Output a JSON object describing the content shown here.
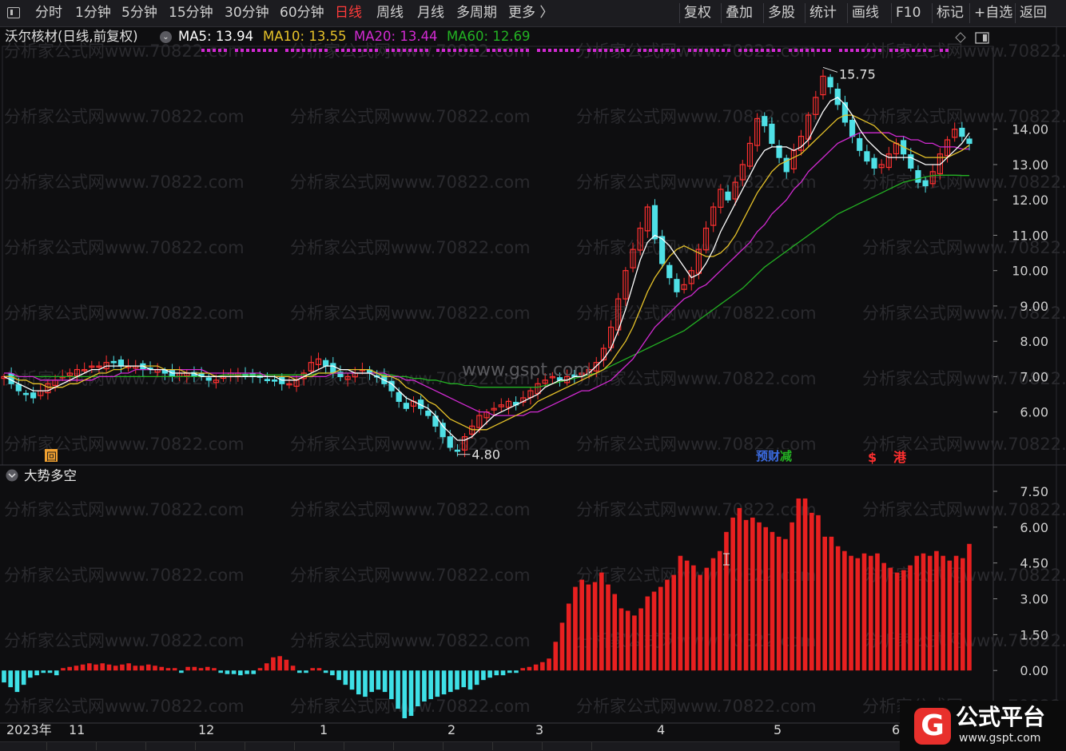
{
  "toolbar": {
    "left": [
      "分时",
      "1分钟",
      "5分钟",
      "15分钟",
      "30分钟",
      "60分钟",
      "日线",
      "周线",
      "月线",
      "多周期",
      "更多 〉"
    ],
    "active_index": 6,
    "right": [
      "复权",
      "叠加",
      "多股",
      "统计",
      "画线",
      "F10",
      "标记",
      "+自选",
      "返回"
    ]
  },
  "info": {
    "stock": "沃尔核材(日线,前复权)",
    "ma": [
      {
        "label": "MA5: 13.94",
        "color": "#ffffff"
      },
      {
        "label": "MA10: 13.55",
        "color": "#e6c229"
      },
      {
        "label": "MA20: 13.44",
        "color": "#d22ad2"
      },
      {
        "label": "MA60: 12.69",
        "color": "#23b223"
      }
    ]
  },
  "indicator": {
    "name": "大势多空"
  },
  "chart_data": {
    "type": "candlestick",
    "price_axis": {
      "ticks": [
        "14.00",
        "13.00",
        "12.00",
        "11.00",
        "10.00",
        "9.00",
        "8.00",
        "7.00",
        "6.00"
      ],
      "range": [
        4.5,
        16.3
      ]
    },
    "indicator_axis": {
      "ticks": [
        "7.50",
        "6.00",
        "4.50",
        "3.00",
        "1.50",
        "0.00"
      ],
      "range": [
        -2.2,
        8.0
      ]
    },
    "x_labels": [
      "2023年",
      "11",
      "12",
      "1",
      "2",
      "3",
      "4",
      "5",
      "6"
    ],
    "high_mark": "15.75",
    "low_mark": "4.80",
    "price_close": [
      7.0,
      6.8,
      6.6,
      6.5,
      6.4,
      6.6,
      6.8,
      6.9,
      7.0,
      7.1,
      7.2,
      7.2,
      7.3,
      7.3,
      7.4,
      7.4,
      7.3,
      7.3,
      7.3,
      7.2,
      7.2,
      7.2,
      7.1,
      7.0,
      7.1,
      7.1,
      7.0,
      7.0,
      6.9,
      6.9,
      7.0,
      7.1,
      7.1,
      7.0,
      7.0,
      7.0,
      6.9,
      6.9,
      6.8,
      6.8,
      6.9,
      7.1,
      7.4,
      7.5,
      7.3,
      7.1,
      7.0,
      7.0,
      7.1,
      7.2,
      7.1,
      7.0,
      6.8,
      6.6,
      6.3,
      6.1,
      6.3,
      6.1,
      5.9,
      5.6,
      5.3,
      5.0,
      4.9,
      5.3,
      5.6,
      5.9,
      6.0,
      6.1,
      6.2,
      6.3,
      6.2,
      6.4,
      6.6,
      6.8,
      6.9,
      7.0,
      6.9,
      7.0,
      7.0,
      7.1,
      7.2,
      7.4,
      7.8,
      8.4,
      9.2,
      10.0,
      10.6,
      11.2,
      11.8,
      10.9,
      10.2,
      9.8,
      9.4,
      9.6,
      10.0,
      10.6,
      11.2,
      11.8,
      12.3,
      12.0,
      12.5,
      13.0,
      13.6,
      14.3,
      14.1,
      13.6,
      13.2,
      12.8,
      13.4,
      13.8,
      14.4,
      14.9,
      15.5,
      15.2,
      14.7,
      14.2,
      13.8,
      13.4,
      13.1,
      12.9,
      13.0,
      13.3,
      13.6,
      13.3,
      12.9,
      12.5,
      12.4,
      12.8,
      13.3,
      13.7,
      14.0,
      13.8,
      13.6
    ],
    "ma5": [
      7.0,
      6.9,
      6.8,
      6.7,
      6.6,
      6.6,
      6.6,
      6.7,
      6.8,
      6.9,
      7.0,
      7.1,
      7.2,
      7.2,
      7.3,
      7.3,
      7.3,
      7.3,
      7.3,
      7.3,
      7.2,
      7.2,
      7.2,
      7.1,
      7.1,
      7.1,
      7.1,
      7.0,
      7.0,
      7.0,
      7.0,
      7.0,
      7.0,
      7.0,
      7.0,
      7.0,
      7.0,
      7.0,
      6.9,
      6.9,
      6.9,
      7.0,
      7.1,
      7.2,
      7.3,
      7.3,
      7.2,
      7.2,
      7.1,
      7.1,
      7.1,
      7.0,
      6.9,
      6.8,
      6.6,
      6.4,
      6.3,
      6.2,
      6.1,
      5.9,
      5.6,
      5.4,
      5.2,
      5.2,
      5.3,
      5.5,
      5.7,
      5.9,
      6.0,
      6.1,
      6.2,
      6.3,
      6.4,
      6.5,
      6.7,
      6.8,
      6.9,
      6.9,
      7.0,
      7.0,
      7.1,
      7.3,
      7.5,
      7.8,
      8.3,
      8.9,
      9.6,
      10.3,
      10.8,
      11.0,
      10.9,
      10.7,
      10.4,
      10.1,
      9.8,
      9.9,
      10.2,
      10.6,
      11.1,
      11.5,
      11.9,
      12.3,
      12.7,
      13.1,
      13.4,
      13.5,
      13.5,
      13.5,
      13.4,
      13.5,
      13.7,
      14.1,
      14.5,
      14.8,
      14.9,
      14.7,
      14.4,
      14.0,
      13.7,
      13.5,
      13.3,
      13.2,
      13.2,
      13.2,
      13.2,
      13.1,
      13.0,
      13.0,
      13.0,
      13.2,
      13.4,
      13.6,
      13.9
    ],
    "ma10": [
      7.0,
      7.0,
      6.9,
      6.9,
      6.8,
      6.8,
      6.7,
      6.7,
      6.7,
      6.8,
      6.8,
      6.9,
      7.0,
      7.1,
      7.1,
      7.2,
      7.2,
      7.3,
      7.3,
      7.3,
      7.3,
      7.3,
      7.2,
      7.2,
      7.2,
      7.1,
      7.1,
      7.1,
      7.1,
      7.0,
      7.0,
      7.0,
      7.0,
      7.0,
      7.0,
      7.0,
      7.0,
      7.0,
      7.0,
      7.0,
      6.9,
      7.0,
      7.0,
      7.1,
      7.1,
      7.1,
      7.2,
      7.2,
      7.2,
      7.2,
      7.2,
      7.1,
      7.0,
      7.0,
      6.9,
      6.7,
      6.6,
      6.5,
      6.3,
      6.2,
      6.0,
      5.8,
      5.7,
      5.6,
      5.5,
      5.5,
      5.5,
      5.6,
      5.7,
      5.8,
      5.9,
      6.0,
      6.1,
      6.3,
      6.4,
      6.5,
      6.6,
      6.7,
      6.8,
      6.9,
      7.0,
      7.1,
      7.2,
      7.4,
      7.7,
      8.0,
      8.4,
      8.9,
      9.4,
      9.8,
      10.1,
      10.4,
      10.6,
      10.7,
      10.6,
      10.5,
      10.4,
      10.4,
      10.5,
      10.7,
      11.0,
      11.4,
      11.8,
      12.2,
      12.5,
      12.8,
      13.0,
      13.1,
      13.2,
      13.3,
      13.5,
      13.7,
      13.9,
      14.1,
      14.3,
      14.4,
      14.4,
      14.3,
      14.2,
      14.1,
      13.9,
      13.7,
      13.6,
      13.5,
      13.4,
      13.3,
      13.2,
      13.2,
      13.2,
      13.2,
      13.3,
      13.4,
      13.55
    ],
    "ma20": [
      7.1,
      7.1,
      7.0,
      7.0,
      7.0,
      6.9,
      6.9,
      6.9,
      6.9,
      6.9,
      6.9,
      6.9,
      6.9,
      7.0,
      7.0,
      7.0,
      7.1,
      7.1,
      7.2,
      7.2,
      7.2,
      7.2,
      7.2,
      7.2,
      7.2,
      7.2,
      7.2,
      7.2,
      7.1,
      7.1,
      7.1,
      7.1,
      7.1,
      7.1,
      7.1,
      7.1,
      7.0,
      7.0,
      7.0,
      7.0,
      7.0,
      7.0,
      7.0,
      7.0,
      7.0,
      7.1,
      7.1,
      7.1,
      7.1,
      7.1,
      7.1,
      7.1,
      7.1,
      7.0,
      7.0,
      6.9,
      6.9,
      6.8,
      6.7,
      6.6,
      6.5,
      6.4,
      6.3,
      6.2,
      6.1,
      6.0,
      6.0,
      5.9,
      5.9,
      5.9,
      5.9,
      5.9,
      6.0,
      6.0,
      6.1,
      6.2,
      6.3,
      6.4,
      6.5,
      6.6,
      6.6,
      6.7,
      6.8,
      6.9,
      7.1,
      7.3,
      7.5,
      7.8,
      8.1,
      8.4,
      8.6,
      8.8,
      9.0,
      9.2,
      9.3,
      9.5,
      9.6,
      9.8,
      10.0,
      10.2,
      10.4,
      10.6,
      10.8,
      11.1,
      11.3,
      11.6,
      11.8,
      12.0,
      12.3,
      12.5,
      12.8,
      13.0,
      13.2,
      13.4,
      13.6,
      13.7,
      13.8,
      13.9,
      13.9,
      13.9,
      13.9,
      13.9,
      13.8,
      13.8,
      13.7,
      13.7,
      13.6,
      13.6,
      13.5,
      13.5,
      13.5,
      13.44,
      13.44
    ],
    "ma60": [
      7.0,
      7.0,
      7.0,
      7.0,
      7.0,
      7.0,
      7.0,
      7.0,
      7.0,
      7.0,
      7.0,
      7.0,
      7.0,
      7.0,
      7.0,
      7.0,
      7.0,
      7.0,
      7.0,
      7.0,
      7.0,
      7.0,
      7.0,
      7.0,
      7.0,
      7.0,
      7.0,
      7.0,
      7.0,
      7.0,
      7.05,
      7.05,
      7.05,
      7.05,
      7.05,
      7.05,
      7.05,
      7.05,
      7.05,
      7.05,
      7.05,
      7.05,
      7.05,
      7.1,
      7.1,
      7.1,
      7.1,
      7.1,
      7.1,
      7.1,
      7.1,
      7.1,
      7.05,
      7.05,
      7.0,
      7.0,
      6.95,
      6.95,
      6.9,
      6.9,
      6.85,
      6.8,
      6.8,
      6.75,
      6.75,
      6.7,
      6.7,
      6.7,
      6.7,
      6.7,
      6.7,
      6.7,
      6.7,
      6.7,
      6.75,
      6.8,
      6.85,
      6.9,
      6.95,
      7.0,
      7.05,
      7.1,
      7.2,
      7.3,
      7.4,
      7.5,
      7.6,
      7.7,
      7.8,
      7.9,
      8.0,
      8.1,
      8.2,
      8.3,
      8.45,
      8.6,
      8.75,
      8.9,
      9.05,
      9.2,
      9.35,
      9.5,
      9.7,
      9.9,
      10.1,
      10.25,
      10.4,
      10.55,
      10.7,
      10.85,
      11.0,
      11.15,
      11.3,
      11.45,
      11.6,
      11.7,
      11.8,
      11.9,
      12.0,
      12.1,
      12.2,
      12.3,
      12.4,
      12.5,
      12.55,
      12.6,
      12.65,
      12.69,
      12.7,
      12.7,
      12.7,
      12.69,
      12.69
    ],
    "indicator_values": [
      -0.5,
      -0.7,
      -0.9,
      -0.6,
      -0.3,
      -0.2,
      -0.1,
      -0.1,
      -0.2,
      0.1,
      0.15,
      0.2,
      0.25,
      0.3,
      0.25,
      0.3,
      0.25,
      0.2,
      0.25,
      0.3,
      0.2,
      0.2,
      0.25,
      0.2,
      0.15,
      0.1,
      0.1,
      -0.1,
      0.15,
      0.15,
      0.1,
      0.15,
      0.1,
      -0.1,
      -0.15,
      -0.15,
      -0.2,
      -0.15,
      -0.15,
      0.1,
      0.3,
      0.55,
      0.6,
      0.45,
      0.2,
      -0.1,
      -0.1,
      0.1,
      0.1,
      -0.1,
      -0.2,
      -0.4,
      -0.6,
      -0.8,
      -1.0,
      -1.1,
      -0.9,
      -0.8,
      -0.9,
      -1.2,
      -1.6,
      -2.0,
      -1.9,
      -1.5,
      -1.3,
      -1.2,
      -1.1,
      -1.0,
      -0.9,
      -0.8,
      -0.7,
      -0.8,
      -0.6,
      -0.4,
      -0.3,
      -0.2,
      -0.2,
      -0.1,
      -0.1,
      0.1,
      0.15,
      0.25,
      0.35,
      0.5,
      1.2,
      2.0,
      2.8,
      3.5,
      3.8,
      3.6,
      3.7,
      4.1,
      3.6,
      3.2,
      2.6,
      2.5,
      2.3,
      2.6,
      3.1,
      3.3,
      3.5,
      3.8,
      4.0,
      4.8,
      4.6,
      4.4,
      4.0,
      4.3,
      4.7,
      5.0,
      5.8,
      6.4,
      6.8,
      6.3,
      6.4,
      6.2,
      6.0,
      5.8,
      5.6,
      5.5,
      6.2,
      7.2,
      7.2,
      6.6,
      6.5,
      5.6,
      5.6,
      5.2,
      5.0,
      4.8,
      4.7,
      4.9,
      4.8,
      4.9,
      4.5,
      4.3,
      4.1,
      4.2,
      4.4,
      4.8,
      4.9,
      4.8,
      5.0,
      4.8,
      4.6,
      4.8,
      4.7,
      5.3
    ]
  },
  "markers": {
    "low_tag": "回",
    "fin_tags": [
      "预",
      "财",
      "减"
    ],
    "hk_tags": [
      "$",
      "港"
    ]
  },
  "watermark": {
    "text": "分析家公式网www.70822.com",
    "center": "www.gspt.com"
  },
  "logo": {
    "mark": "G",
    "title": "公式平台",
    "url": "www.gspt.com"
  }
}
